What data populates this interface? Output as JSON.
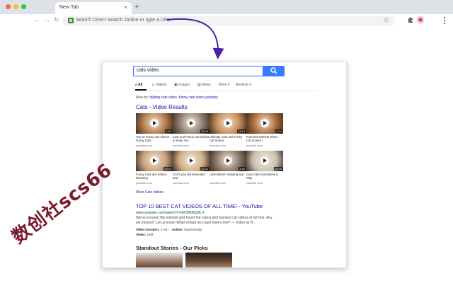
{
  "browser": {
    "tab_title": "New Tab",
    "tab_close": "×",
    "new_tab": "+",
    "back": "←",
    "forward": "→",
    "reload": "↻",
    "omnibox_placeholder": "Search Direct Search Online or type a URL",
    "star": "☆",
    "extension_puzzle": "✦",
    "colors": {
      "close": "#ff5f57",
      "minimize": "#febc2e",
      "zoom": "#28c840"
    }
  },
  "search": {
    "query": "cats video",
    "tabs": [
      {
        "label": "All",
        "icon": "search-icon"
      },
      {
        "label": "Videos",
        "icon": "play-icon"
      },
      {
        "label": "Images",
        "icon": "image-icon"
      },
      {
        "label": "News",
        "icon": "news-icon"
      },
      {
        "label": "More",
        "icon": "chevron-down-icon"
      },
      {
        "label": "Anytime",
        "icon": "chevron-down-icon"
      }
    ],
    "also_try_label": "Also try:",
    "also_try_links": "talking cats video, funny cats video youtube",
    "video_section_title": "Cats - Video Results",
    "videos": [
      {
        "title": "Top 10 Funny Cat Videos - Funny Cats",
        "source": "youtube.com",
        "duration": "4:00",
        "color": "#b07a4a"
      },
      {
        "title": "Cute and Funny Cat Videos to Keep You",
        "source": "youtube.com",
        "duration": "10:40",
        "color": "#8f7f70"
      },
      {
        "title": "Ultimate Cute and Funny Cat Videos",
        "source": "youtube.com",
        "duration": "11:14",
        "color": "#c58b58"
      },
      {
        "title": "Funniest Moment When Cat Scared |",
        "source": "youtube.com",
        "duration": "4:24",
        "color": "#a86a3a"
      },
      {
        "title": "Funny Cats and Kittens Meowing",
        "source": "youtube.com",
        "duration": "10:02",
        "color": "#c7a07a"
      },
      {
        "title": "CATS you will remember and",
        "source": "youtube.com",
        "duration": "10:11",
        "color": "#d2b088"
      },
      {
        "title": "Little kittens meowing and",
        "source": "youtube.com",
        "duration": "3:16",
        "color": "#8a7868"
      },
      {
        "title": "Cute Cats And Kittens & Kitty",
        "source": "youtube.com",
        "duration": "10:05",
        "color": "#c9c2b0"
      }
    ],
    "more_videos": "More Cats videos",
    "result": {
      "title": "TOP 10 BEST CAT VIDEOS OF ALL TIME! - YouTube",
      "url": "www.youtube.com/watch?v=tbP2NIBQdfc ▾",
      "snippet": "We've scoured the Internet and found the cutest and funniest cat videos of all time. Any we missed? Let us know! What should we count down next? — Video by B...",
      "duration_label": "Video Duration:",
      "duration_value": "3 min",
      "author_label": "Author:",
      "author_value": "WatchItDaily",
      "views_label": "Views:",
      "views_value": "16M"
    },
    "stories_title": "Standout Stories - Our Picks"
  },
  "watermark": "数创社scs66"
}
